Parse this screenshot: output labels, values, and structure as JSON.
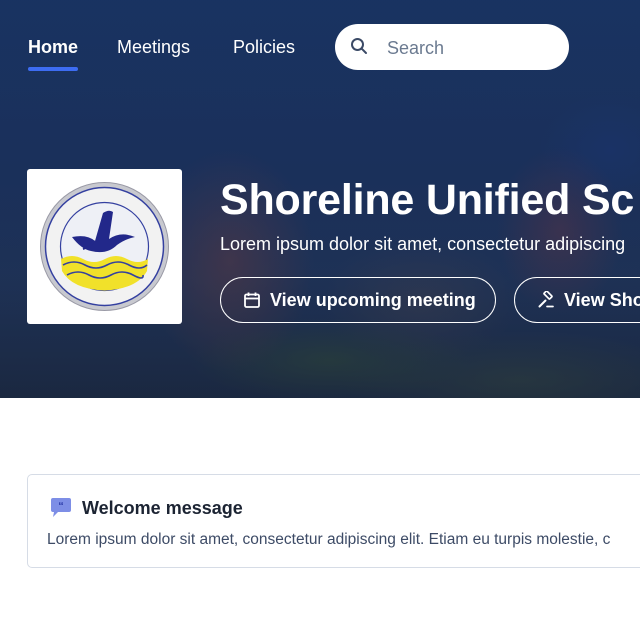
{
  "nav": {
    "items": [
      {
        "label": "Home",
        "active": true
      },
      {
        "label": "Meetings",
        "active": false
      },
      {
        "label": "Policies",
        "active": false
      }
    ],
    "search": {
      "placeholder": "Search",
      "icon": "search-icon"
    }
  },
  "hero": {
    "logo": {
      "text": "SHORELINE UNIFIED SCHOOL DISTRICT",
      "motto": "TOMALES • SCHOOLS"
    },
    "title": "Shoreline Unified Sc",
    "tagline": "Lorem ipsum dolor sit amet, consectetur adipiscing",
    "buttons": [
      {
        "label": "View upcoming meeting",
        "icon": "calendar-icon"
      },
      {
        "label": "View Sho",
        "icon": "gavel-icon"
      }
    ]
  },
  "welcome": {
    "icon": "quote-icon",
    "title": "Welcome message",
    "body": "Lorem ipsum dolor sit amet, consectetur adipiscing elit. Etiam eu turpis molestie, c"
  },
  "colors": {
    "accent": "#3d6cf2",
    "hero": "#1d3560",
    "welcome_icon": "#5b6ee1"
  }
}
